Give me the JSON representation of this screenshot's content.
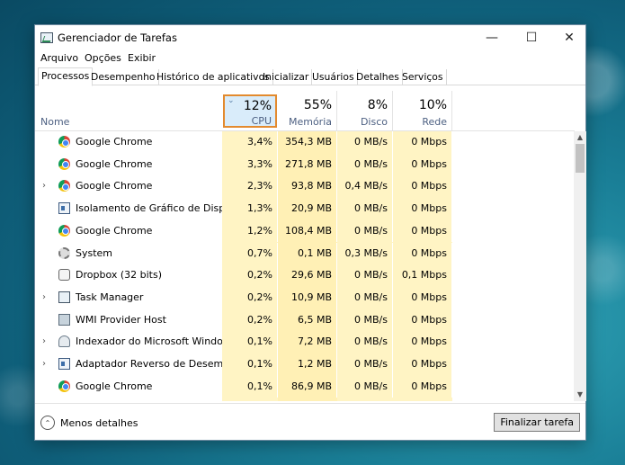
{
  "window": {
    "title": "Gerenciador de Tarefas"
  },
  "controls": {
    "minimize": "—",
    "maximize": "☐",
    "close": "✕"
  },
  "menu": [
    "Arquivo",
    "Opções",
    "Exibir"
  ],
  "tabs": [
    "Processos",
    "Desempenho",
    "Histórico de aplicativos",
    "Inicializar",
    "Usuários",
    "Detalhes",
    "Serviços"
  ],
  "header": {
    "name": "Nome",
    "cpu": {
      "pct": "12%",
      "label": "CPU"
    },
    "mem": {
      "pct": "55%",
      "label": "Memória"
    },
    "disk": {
      "pct": "8%",
      "label": "Disco"
    },
    "net": {
      "pct": "10%",
      "label": "Rede"
    }
  },
  "rows": [
    {
      "name": "Google Chrome",
      "icon": "chrome-icon",
      "expandable": false,
      "cpu": "3,4%",
      "mem": "354,3 MB",
      "disk": "0 MB/s",
      "net": "0 Mbps"
    },
    {
      "name": "Google Chrome",
      "icon": "chrome-icon",
      "expandable": false,
      "cpu": "3,3%",
      "mem": "271,8 MB",
      "disk": "0 MB/s",
      "net": "0 Mbps"
    },
    {
      "name": "Google Chrome",
      "icon": "chrome-icon",
      "expandable": true,
      "cpu": "2,3%",
      "mem": "93,8 MB",
      "disk": "0,4 MB/s",
      "net": "0 Mbps"
    },
    {
      "name": "Isolamento de Gráfico de Dispo...",
      "icon": "window-icon",
      "expandable": false,
      "cpu": "1,3%",
      "mem": "20,9 MB",
      "disk": "0 MB/s",
      "net": "0 Mbps"
    },
    {
      "name": "Google Chrome",
      "icon": "chrome-icon",
      "expandable": false,
      "cpu": "1,2%",
      "mem": "108,4 MB",
      "disk": "0 MB/s",
      "net": "0 Mbps"
    },
    {
      "name": "System",
      "icon": "system-icon",
      "expandable": false,
      "cpu": "0,7%",
      "mem": "0,1 MB",
      "disk": "0,3 MB/s",
      "net": "0 Mbps"
    },
    {
      "name": "Dropbox (32 bits)",
      "icon": "dropbox-icon",
      "expandable": false,
      "cpu": "0,2%",
      "mem": "29,6 MB",
      "disk": "0 MB/s",
      "net": "0,1 Mbps"
    },
    {
      "name": "Task Manager",
      "icon": "task-manager-icon",
      "expandable": true,
      "cpu": "0,2%",
      "mem": "10,9 MB",
      "disk": "0 MB/s",
      "net": "0 Mbps"
    },
    {
      "name": "WMI Provider Host",
      "icon": "wmi-icon",
      "expandable": false,
      "cpu": "0,2%",
      "mem": "6,5 MB",
      "disk": "0 MB/s",
      "net": "0 Mbps"
    },
    {
      "name": "Indexador do Microsoft Windo...",
      "icon": "indexer-icon",
      "expandable": true,
      "cpu": "0,1%",
      "mem": "7,2 MB",
      "disk": "0 MB/s",
      "net": "0 Mbps"
    },
    {
      "name": "Adaptador Reverso de Desempe...",
      "icon": "window-icon",
      "expandable": true,
      "cpu": "0,1%",
      "mem": "1,2 MB",
      "disk": "0 MB/s",
      "net": "0 Mbps"
    },
    {
      "name": "Google Chrome",
      "icon": "chrome-icon",
      "expandable": false,
      "cpu": "0,1%",
      "mem": "86,9 MB",
      "disk": "0 MB/s",
      "net": "0 Mbps"
    }
  ],
  "footer": {
    "less_details": "Menos detalhes",
    "end_task": "Finalizar tarefa"
  }
}
